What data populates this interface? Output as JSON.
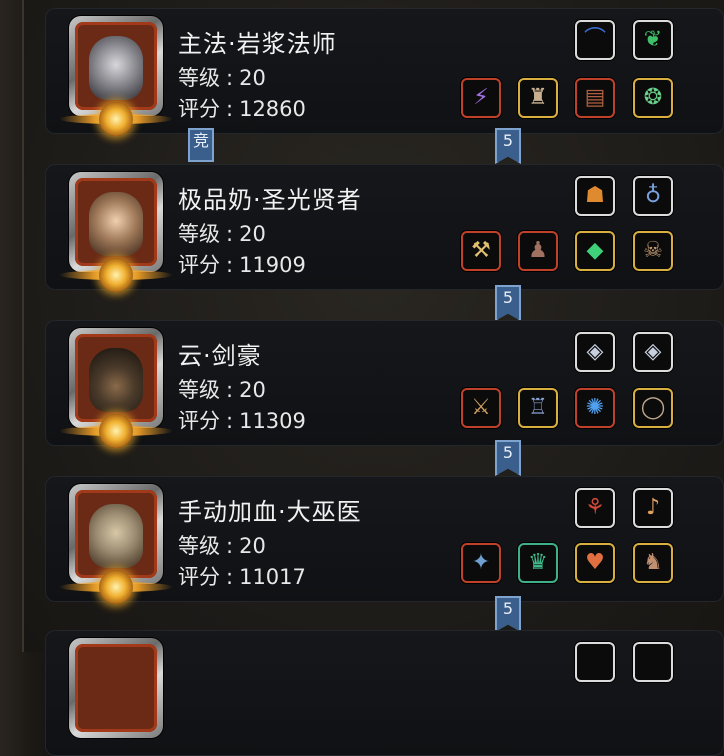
{
  "characters": [
    {
      "name": "主法·岩浆法师",
      "level_label": "等级",
      "level": "20",
      "score_label": "评分",
      "score": "12860",
      "face_color": "#8a8a90",
      "top_slots": [
        {
          "icon": "bow-icon",
          "glyph": "⌒",
          "rarity": "white"
        },
        {
          "icon": "green-trinket-icon",
          "glyph": "❦",
          "rarity": "white"
        }
      ],
      "bottom_slots": [
        {
          "icon": "staff-icon",
          "glyph": "⚡",
          "rarity": "red"
        },
        {
          "icon": "robe-icon",
          "glyph": "♜",
          "rarity": "gold"
        },
        {
          "icon": "tome-icon",
          "glyph": "▤",
          "rarity": "red"
        },
        {
          "icon": "amulet-icon",
          "glyph": "❂",
          "rarity": "gold"
        }
      ],
      "tags": [
        {
          "text": "竞",
          "kind": "tab"
        },
        {
          "text": "5",
          "kind": "flag"
        }
      ]
    },
    {
      "name": "极品奶·圣光贤者",
      "level_label": "等级",
      "level": "20",
      "score_label": "评分",
      "score": "11909",
      "face_color": "#a07a5a",
      "top_slots": [
        {
          "icon": "lantern-icon",
          "glyph": "☗",
          "rarity": "white"
        },
        {
          "icon": "necklace-icon",
          "glyph": "♁",
          "rarity": "white"
        }
      ],
      "bottom_slots": [
        {
          "icon": "hammer-icon",
          "glyph": "⚒",
          "rarity": "red"
        },
        {
          "icon": "cloak-icon",
          "glyph": "♟",
          "rarity": "red"
        },
        {
          "icon": "emerald-icon",
          "glyph": "◆",
          "rarity": "gold"
        },
        {
          "icon": "skull-mask-icon",
          "glyph": "☠",
          "rarity": "gold"
        }
      ],
      "tags": [
        {
          "text": "5",
          "kind": "flag"
        }
      ]
    },
    {
      "name": "云·剑豪",
      "level_label": "等级",
      "level": "20",
      "score_label": "评分",
      "score": "11309",
      "face_color": "#4a3a2a",
      "top_slots": [
        {
          "icon": "rank-emblem-icon",
          "glyph": "◈",
          "rarity": "white"
        },
        {
          "icon": "rank-emblem-icon",
          "glyph": "◈",
          "rarity": "white"
        }
      ],
      "bottom_slots": [
        {
          "icon": "sword-icon",
          "glyph": "⚔",
          "rarity": "red"
        },
        {
          "icon": "armor-icon",
          "glyph": "♖",
          "rarity": "gold"
        },
        {
          "icon": "blue-orb-icon",
          "glyph": "✺",
          "rarity": "red"
        },
        {
          "icon": "ring-icon",
          "glyph": "◯",
          "rarity": "gold"
        }
      ],
      "tags": [
        {
          "text": "5",
          "kind": "flag"
        }
      ]
    },
    {
      "name": "手动加血·大巫医",
      "level_label": "等级",
      "level": "20",
      "score_label": "评分",
      "score": "11017",
      "face_color": "#9a8a70",
      "top_slots": [
        {
          "icon": "feather-charm-icon",
          "glyph": "⚘",
          "rarity": "white"
        },
        {
          "icon": "bell-icon",
          "glyph": "♪",
          "rarity": "white"
        }
      ],
      "bottom_slots": [
        {
          "icon": "rod-icon",
          "glyph": "✦",
          "rarity": "red"
        },
        {
          "icon": "vest-icon",
          "glyph": "♛",
          "rarity": "teal"
        },
        {
          "icon": "heart-amulet-icon",
          "glyph": "♥",
          "rarity": "gold"
        },
        {
          "icon": "boots-icon",
          "glyph": "♞",
          "rarity": "gold"
        }
      ],
      "tags": [
        {
          "text": "5",
          "kind": "flag"
        }
      ]
    }
  ]
}
